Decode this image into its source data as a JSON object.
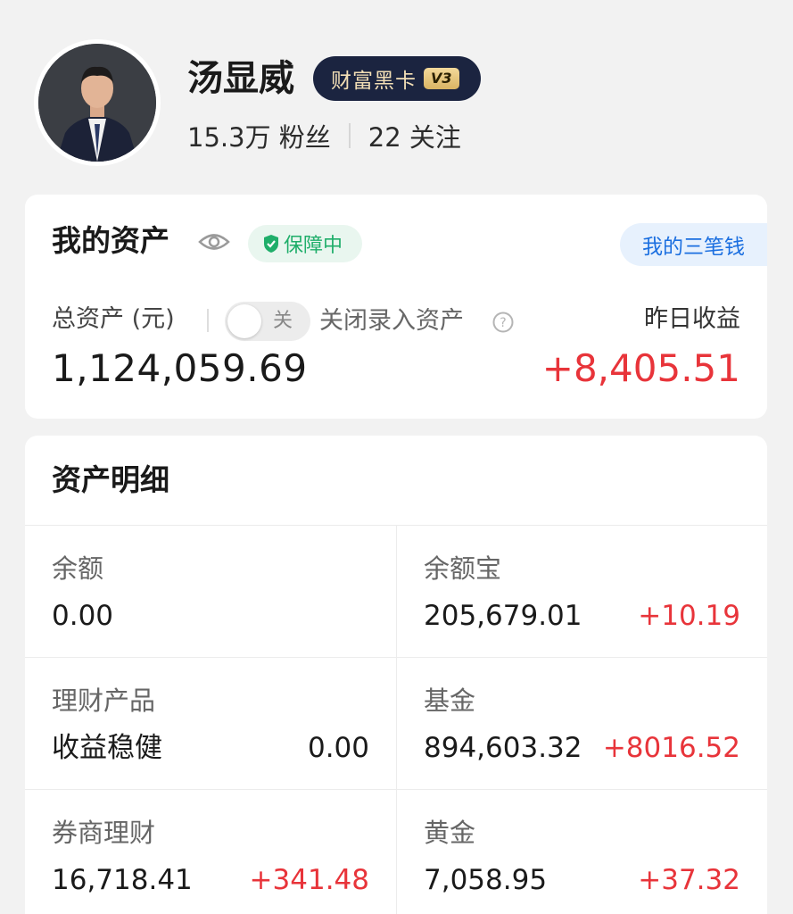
{
  "profile": {
    "name": "汤显威",
    "vip_label": "财富黑卡",
    "vip_level": "V3",
    "fans": "15.3万 粉丝",
    "following": "22 关注"
  },
  "assets": {
    "title": "我的资产",
    "guard_label": "保障中",
    "three_money_label": "我的三笔钱",
    "total_label": "总资产 (元)",
    "toggle_text": "关",
    "close_entry_label": "关闭录入资产",
    "total_value": "1,124,059.69",
    "yesterday_label": "昨日收益",
    "yesterday_value": "+8,405.51"
  },
  "details": {
    "title": "资产明细",
    "items": [
      {
        "label": "余额",
        "amount": "0.00",
        "change": ""
      },
      {
        "label": "余额宝",
        "amount": "205,679.01",
        "change": "+10.19"
      },
      {
        "label": "理财产品",
        "amount": "收益稳健",
        "change": "0.00"
      },
      {
        "label": "基金",
        "amount": "894,603.32",
        "change": "+8016.52"
      },
      {
        "label": "券商理财",
        "amount": "16,718.41",
        "change": "+341.48"
      },
      {
        "label": "黄金",
        "amount": "7,058.95",
        "change": "+37.32"
      }
    ]
  },
  "colors": {
    "accent_red": "#e8343a",
    "accent_blue": "#1b6fe0",
    "guard_green": "#1fae6a",
    "vip_dark": "#1b2440"
  },
  "icons": [
    "eye-icon",
    "shield-check-icon",
    "help-icon"
  ]
}
